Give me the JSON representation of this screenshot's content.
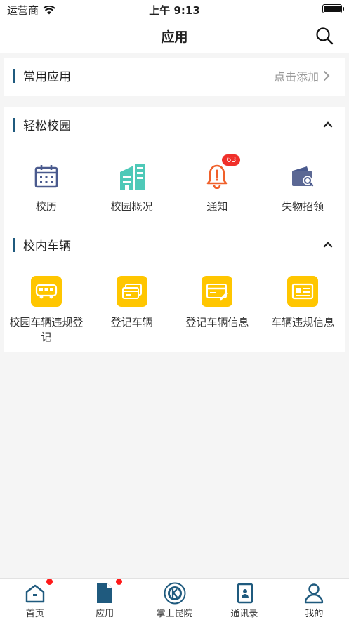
{
  "status": {
    "carrier": "运营商",
    "time": "上午 9:13"
  },
  "nav": {
    "title": "应用",
    "search_icon": "search-icon"
  },
  "common": {
    "title": "常用应用",
    "action": "点击添加"
  },
  "campus": {
    "title": "轻松校园",
    "items": [
      {
        "label": "校历",
        "icon": "calendar-icon"
      },
      {
        "label": "校园概况",
        "icon": "building-icon"
      },
      {
        "label": "通知",
        "icon": "bell-icon",
        "badge": "63"
      },
      {
        "label": "失物招领",
        "icon": "wallet-search-icon"
      }
    ]
  },
  "vehicle": {
    "title": "校内车辆",
    "items": [
      {
        "label": "校园车辆违规登记",
        "icon": "bus-icon"
      },
      {
        "label": "登记车辆",
        "icon": "cards-icon"
      },
      {
        "label": "登记车辆信息",
        "icon": "card-edit-icon"
      },
      {
        "label": "车辆违规信息",
        "icon": "id-card-icon"
      }
    ]
  },
  "tabbar": {
    "items": [
      {
        "label": "首页",
        "icon": "home-icon",
        "dot": true
      },
      {
        "label": "应用",
        "icon": "document-icon",
        "dot": true,
        "active": true
      },
      {
        "label": "掌上昆院",
        "icon": "school-logo-icon"
      },
      {
        "label": "通讯录",
        "icon": "contacts-icon"
      },
      {
        "label": "我的",
        "icon": "person-icon"
      }
    ]
  },
  "colors": {
    "accent": "#1f5a7e",
    "yellow": "#ffc600",
    "badge": "#f0302a",
    "calendar": "#4a5a8e",
    "building": "#4ec9b8",
    "bell": "#f0602a"
  }
}
